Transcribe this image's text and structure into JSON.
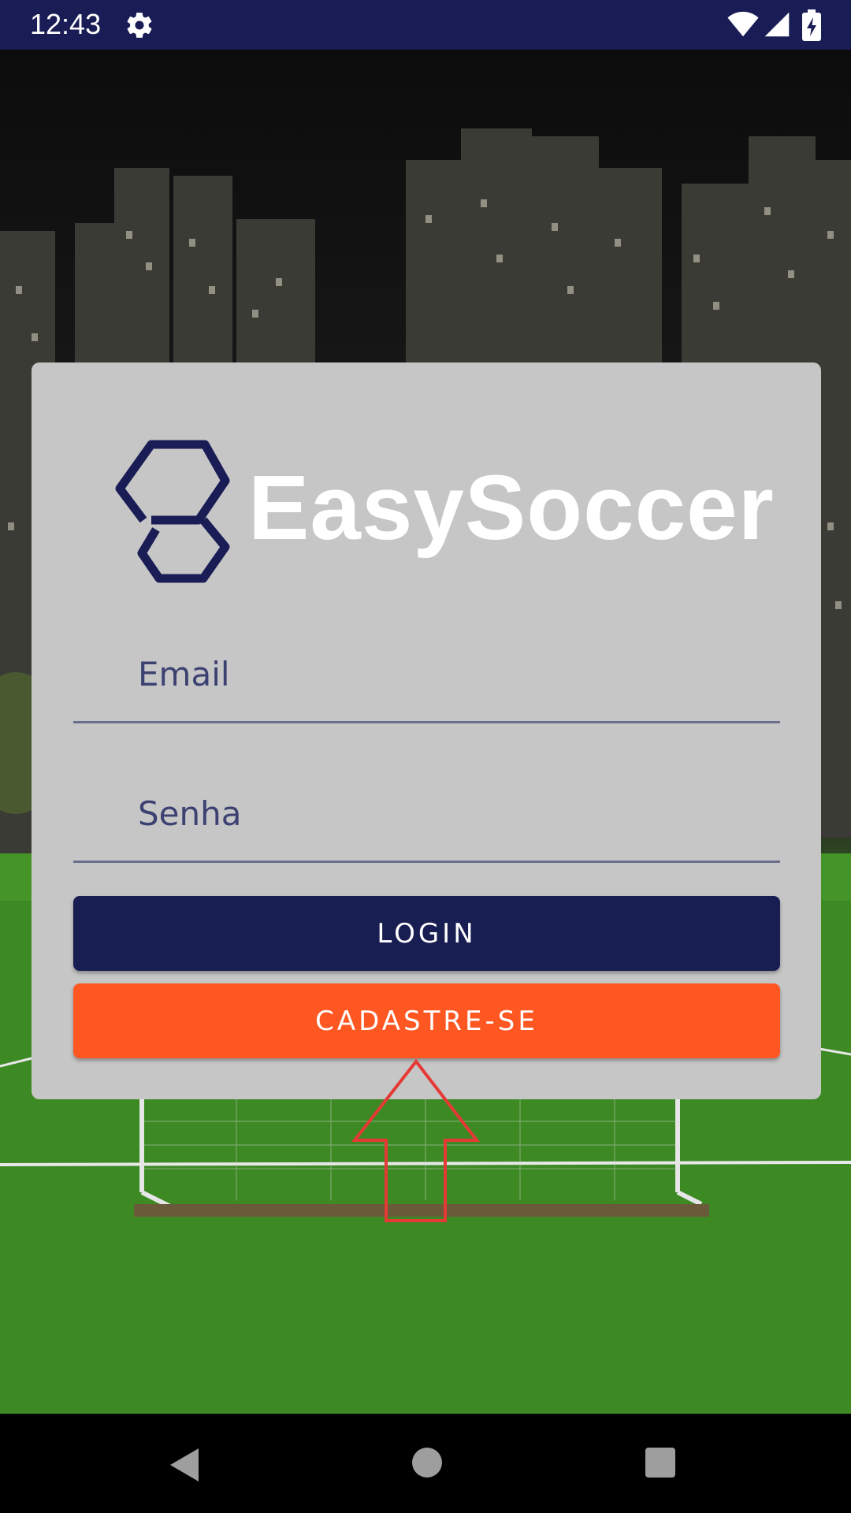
{
  "status_bar": {
    "time": "12:43",
    "icons": [
      "settings-gear-icon",
      "wifi-icon",
      "cellular-signal-icon",
      "battery-charging-icon"
    ]
  },
  "brand": {
    "name": "EasySoccer",
    "logo_icon": "hexagon-s-logo-icon"
  },
  "form": {
    "email_placeholder": "Email",
    "email_value": "",
    "password_placeholder": "Senha",
    "password_value": "",
    "login_label": "LOGIN",
    "signup_label": "CADASTRE-SE"
  },
  "annotation": {
    "icon": "red-up-arrow-icon",
    "color": "#e53935"
  },
  "nav_bar": {
    "icons": [
      "back-triangle-icon",
      "home-circle-icon",
      "recents-square-icon"
    ]
  },
  "colors": {
    "status_bar": "#1a1d55",
    "card": "#c6c6c6",
    "login_button": "#181d52",
    "signup_button": "#ff5722",
    "logo_mark": "#1a1d55",
    "logo_text": "#ffffff"
  }
}
